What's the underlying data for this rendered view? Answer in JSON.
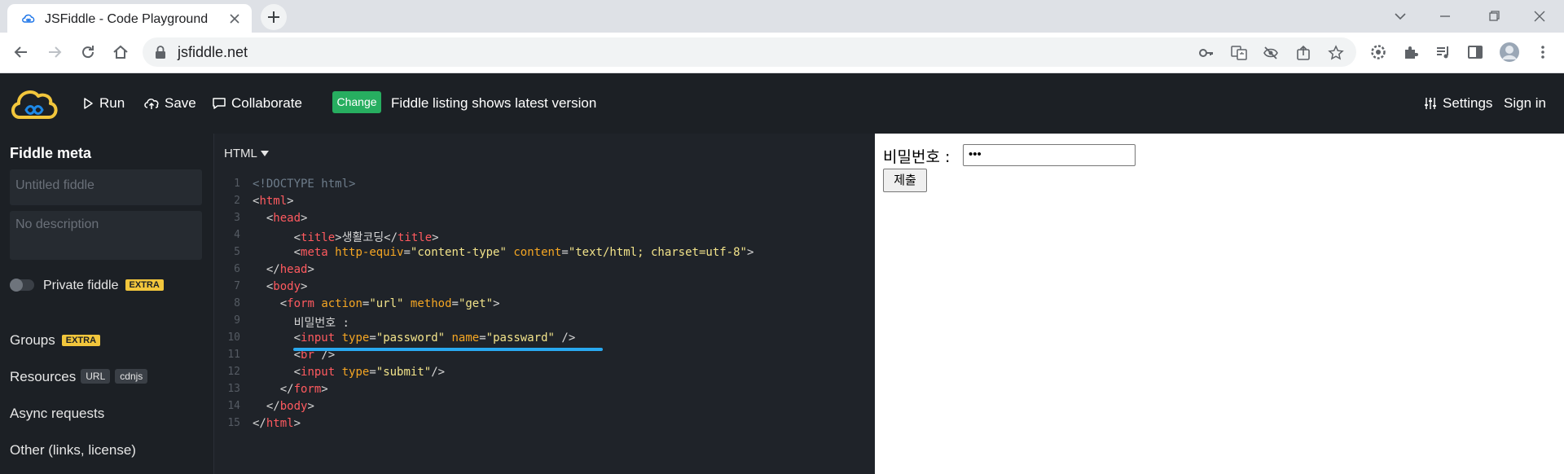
{
  "browser": {
    "tab_title": "JSFiddle - Code Playground",
    "url": "jsfiddle.net"
  },
  "header": {
    "run_label": "Run",
    "save_label": "Save",
    "collaborate_label": "Collaborate",
    "change_label": "Change",
    "listing_text": "Fiddle listing shows latest version",
    "settings_label": "Settings",
    "signin_label": "Sign in"
  },
  "sidebar": {
    "title": "Fiddle meta",
    "title_placeholder": "Untitled fiddle",
    "description_placeholder": "No description",
    "private_label": "Private fiddle",
    "extra_badge": "EXTRA",
    "groups_label": "Groups",
    "resources_label": "Resources",
    "url_tag": "URL",
    "cdnjs_tag": "cdnjs",
    "async_label": "Async requests",
    "other_label": "Other (links, license)"
  },
  "editor": {
    "language": "HTML",
    "lines": [
      "<!DOCTYPE html>",
      "<html>",
      "  <head>",
      "      <title>생활코딩</title>",
      "      <meta http-equiv=\"content-type\" content=\"text/html; charset=utf-8\">",
      "  </head>",
      "  <body>",
      "    <form action=\"url\" method=\"get\">",
      "      비밀번호 :",
      "      <input type=\"password\" name=\"passward\" />",
      "      <br />",
      "      <input type=\"submit\"/>",
      "    </form>",
      "  </body>",
      "</html>"
    ]
  },
  "result": {
    "label": "비밀번호 :",
    "password_value": "•••",
    "submit_label": "제출"
  },
  "colors": {
    "header_bg": "#1c2025",
    "editor_bg": "#1f2329",
    "change_green": "#27ae60",
    "extra_yellow": "#f2c63c",
    "underline_blue": "#29a9f0"
  }
}
